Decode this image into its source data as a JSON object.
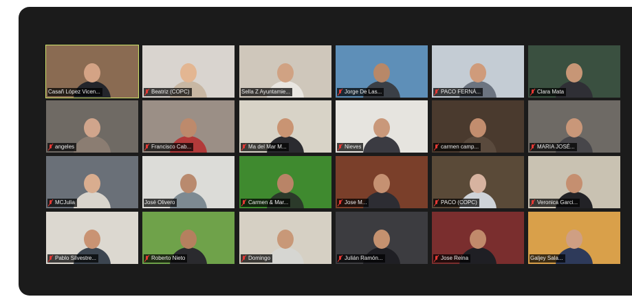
{
  "meeting": {
    "participants": [
      {
        "name": "Casañ López Vicen...",
        "muted": false,
        "speaking": true,
        "bg": "#8a6b52",
        "skin": "#d4a385",
        "shirt": "#23252b"
      },
      {
        "name": "Beatriz (COPC)",
        "muted": true,
        "bg": "#d9d4cf",
        "skin": "#e3b692",
        "shirt": "#c8b7a3"
      },
      {
        "name": "Sella Z Ayuntamie...",
        "muted": false,
        "bg": "#cfc7bb",
        "skin": "#d0a283",
        "shirt": "#e9e6e1"
      },
      {
        "name": "Jorge De Las...",
        "muted": true,
        "bg": "#5e8fb8",
        "skin": "#b88868",
        "shirt": "#3a3f46"
      },
      {
        "name": "PACO FERNÁ...",
        "muted": true,
        "bg": "#c4ccd4",
        "skin": "#cf9b7b",
        "shirt": "#6c7480"
      },
      {
        "name": "Clara Mata",
        "muted": true,
        "bg": "#3a5040",
        "skin": "#c79676",
        "shirt": "#2f2f35"
      },
      {
        "name": "angeles",
        "muted": true,
        "bg": "#6f6a64",
        "skin": "#d0a58c",
        "shirt": "#8b7d72"
      },
      {
        "name": "Francisco Cab...",
        "muted": true,
        "bg": "#9b8f86",
        "skin": "#bd8a6c",
        "shirt": "#b23a3a"
      },
      {
        "name": "Ma del Mar M...",
        "muted": true,
        "bg": "#d8d3c7",
        "skin": "#c99473",
        "shirt": "#2b2b30"
      },
      {
        "name": "Nieves",
        "muted": true,
        "bg": "#e6e4df",
        "skin": "#c9987a",
        "shirt": "#3b3b42"
      },
      {
        "name": "carmen camp...",
        "muted": true,
        "bg": "#4a3a2e",
        "skin": "#c28d6e",
        "shirt": "#5a4a3d"
      },
      {
        "name": "MARIA JOSÉ...",
        "muted": true,
        "bg": "#6e6a65",
        "skin": "#c99779",
        "shirt": "#47464a"
      },
      {
        "name": "MCJulia",
        "muted": true,
        "bg": "#6a7078",
        "skin": "#d9ad8f",
        "shirt": "#d9d4cc"
      },
      {
        "name": "José Olivero",
        "muted": false,
        "bg": "#dcdcd8",
        "skin": "#b98a6e",
        "shirt": "#7d8a92"
      },
      {
        "name": "Carmen & Mar...",
        "muted": true,
        "bg": "#3f8a2f",
        "skin": "#b98467",
        "shirt": "#2b3a2a"
      },
      {
        "name": "Jose M...",
        "muted": true,
        "bg": "#7a3f2a",
        "skin": "#c59172",
        "shirt": "#2d2d33"
      },
      {
        "name": "PACO (COPC)",
        "muted": true,
        "bg": "#5a4a38",
        "skin": "#d7b3a0",
        "shirt": "#cfd3d8"
      },
      {
        "name": "Veronica Garci...",
        "muted": true,
        "bg": "#c9c2b2",
        "skin": "#c58f70",
        "shirt": "#222226"
      },
      {
        "name": "Pablo Silvestre...",
        "muted": true,
        "bg": "#dcd8d0",
        "skin": "#c99373",
        "shirt": "#3c4550"
      },
      {
        "name": "Roberto Nieto",
        "muted": true,
        "bg": "#6fa24a",
        "skin": "#b5805f",
        "shirt": "#2a2a2e"
      },
      {
        "name": "Domingo",
        "muted": true,
        "bg": "#d6d0c4",
        "skin": "#c89878",
        "shirt": "#d6d6d2"
      },
      {
        "name": "Julián Ramón...",
        "muted": true,
        "bg": "#3c3c40",
        "skin": "#c4916f",
        "shirt": "#1f1f24"
      },
      {
        "name": "Jose Reina",
        "muted": true,
        "bg": "#7a2e2e",
        "skin": "#c18a6b",
        "shirt": "#1f1f24"
      },
      {
        "name": "Galjey Sala...",
        "muted": false,
        "bg": "#d9a04a",
        "skin": "#cf9f83",
        "shirt": "#2e3a5a"
      }
    ]
  }
}
